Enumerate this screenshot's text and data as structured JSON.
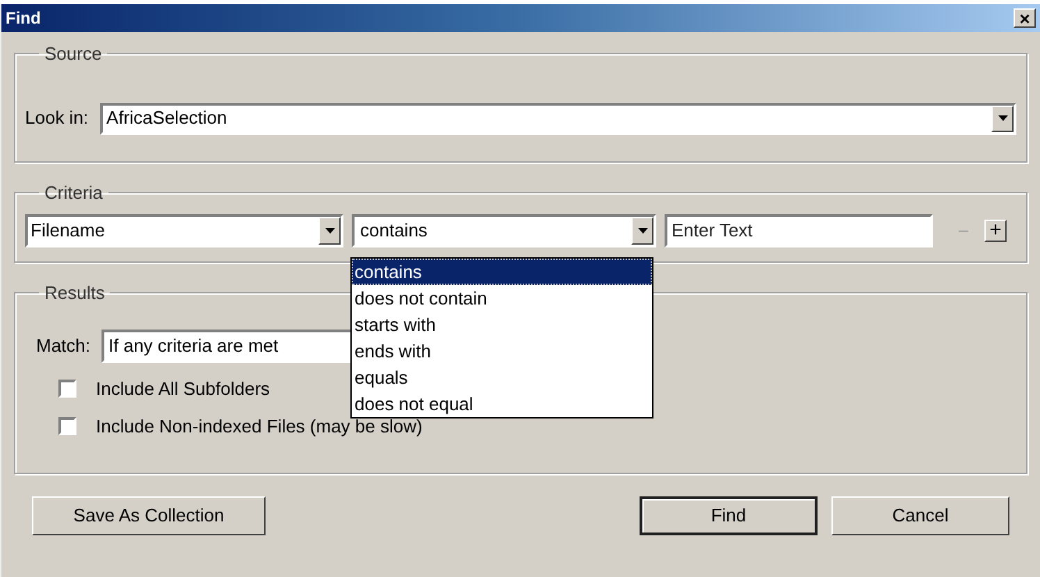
{
  "window": {
    "title": "Find",
    "close": "×"
  },
  "source": {
    "legend": "Source",
    "look_in_label": "Look in:",
    "look_in_value": "AfricaSelection"
  },
  "criteria": {
    "legend": "Criteria",
    "field": "Filename",
    "operator": "contains",
    "text_placeholder": "Enter Text",
    "remove_disabled": true,
    "remove": "−",
    "add": "+"
  },
  "operator_options": [
    {
      "label": "contains",
      "selected": true
    },
    {
      "label": "does not contain",
      "selected": false
    },
    {
      "label": "starts with",
      "selected": false
    },
    {
      "label": "ends with",
      "selected": false
    },
    {
      "label": "equals",
      "selected": false
    },
    {
      "label": "does not equal",
      "selected": false
    }
  ],
  "results": {
    "legend": "Results",
    "match_label": "Match:",
    "match_value": "If any criteria are met",
    "options": [
      {
        "label": "Include All Subfolders",
        "checked": false
      },
      {
        "label": "Include Non-indexed Files (may be slow)",
        "checked": false
      }
    ]
  },
  "buttons": {
    "save": "Save As Collection",
    "find": "Find",
    "cancel": "Cancel"
  }
}
